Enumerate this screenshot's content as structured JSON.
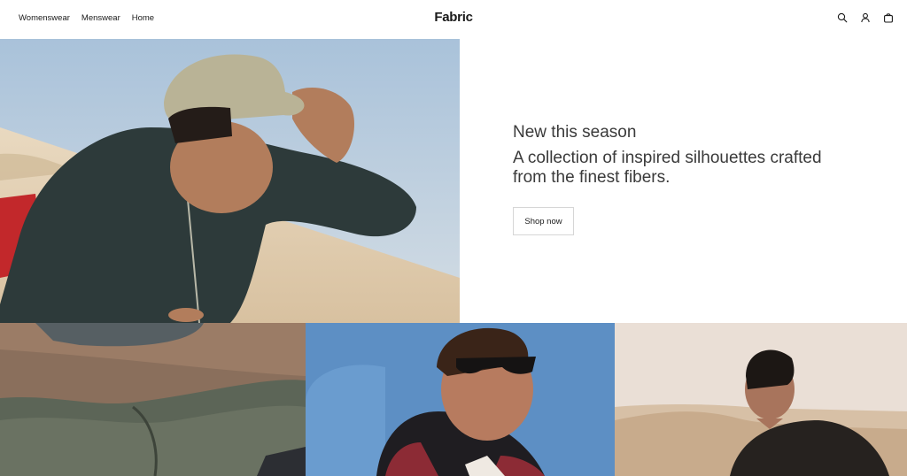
{
  "nav": {
    "items": [
      {
        "label": "Womenswear"
      },
      {
        "label": "Menswear"
      },
      {
        "label": "Home"
      }
    ]
  },
  "brand": {
    "name": "Fabric"
  },
  "header_icons": [
    "search-icon",
    "account-icon",
    "bag-icon"
  ],
  "hero": {
    "eyebrow": "New this season",
    "headline": "A collection of inspired silhouettes crafted from the finest fibers.",
    "cta_label": "Shop now"
  },
  "colors": {
    "text": "#1a1a1a",
    "muted_text": "#3a3a3a",
    "button_border": "#d6d6d6",
    "background": "#ffffff"
  }
}
